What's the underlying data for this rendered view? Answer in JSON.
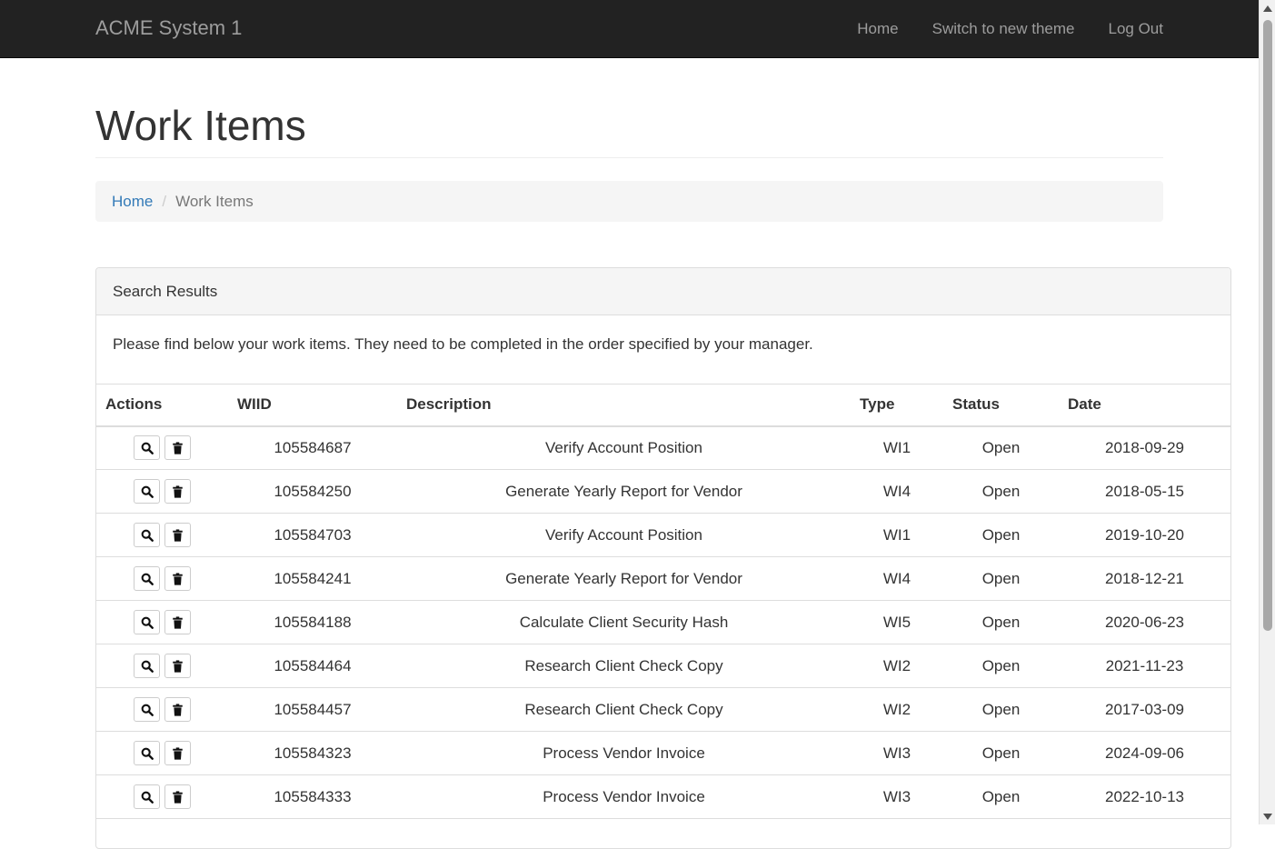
{
  "navbar": {
    "brand": "ACME System 1",
    "links": [
      "Home",
      "Switch to new theme",
      "Log Out"
    ]
  },
  "page": {
    "title": "Work Items"
  },
  "breadcrumb": {
    "home": "Home",
    "separator": "/",
    "current": "Work Items"
  },
  "panel": {
    "heading": "Search Results",
    "body": "Please find below your work items. They need to be completed in the order specified by your manager."
  },
  "table": {
    "headers": [
      "Actions",
      "WIID",
      "Description",
      "Type",
      "Status",
      "Date"
    ],
    "rows": [
      {
        "wiid": "105584687",
        "description": "Verify Account Position",
        "type": "WI1",
        "status": "Open",
        "date": "2018-09-29"
      },
      {
        "wiid": "105584250",
        "description": "Generate Yearly Report for Vendor",
        "type": "WI4",
        "status": "Open",
        "date": "2018-05-15"
      },
      {
        "wiid": "105584703",
        "description": "Verify Account Position",
        "type": "WI1",
        "status": "Open",
        "date": "2019-10-20"
      },
      {
        "wiid": "105584241",
        "description": "Generate Yearly Report for Vendor",
        "type": "WI4",
        "status": "Open",
        "date": "2018-12-21"
      },
      {
        "wiid": "105584188",
        "description": "Calculate Client Security Hash",
        "type": "WI5",
        "status": "Open",
        "date": "2020-06-23"
      },
      {
        "wiid": "105584464",
        "description": "Research Client Check Copy",
        "type": "WI2",
        "status": "Open",
        "date": "2021-11-23"
      },
      {
        "wiid": "105584457",
        "description": "Research Client Check Copy",
        "type": "WI2",
        "status": "Open",
        "date": "2017-03-09"
      },
      {
        "wiid": "105584323",
        "description": "Process Vendor Invoice",
        "type": "WI3",
        "status": "Open",
        "date": "2024-09-06"
      },
      {
        "wiid": "105584333",
        "description": "Process Vendor Invoice",
        "type": "WI3",
        "status": "Open",
        "date": "2022-10-13"
      }
    ]
  },
  "icons": {
    "view": "search-icon",
    "delete": "trash-icon"
  },
  "colors": {
    "navbar_bg": "#222222",
    "navbar_text": "#9d9d9d",
    "link": "#337ab7",
    "panel_heading_bg": "#f5f5f5",
    "border": "#dddddd"
  }
}
